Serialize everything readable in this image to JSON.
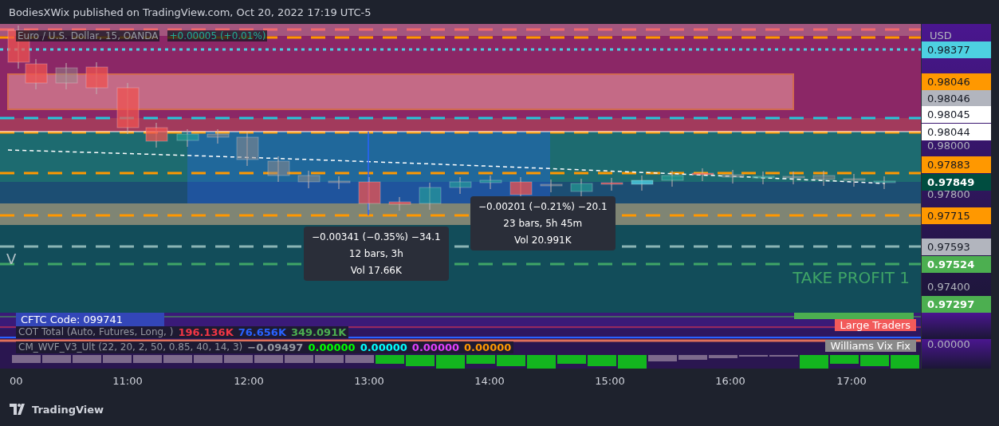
{
  "header": {
    "title": "BodiesXWix published on TradingView.com, Oct 20, 2022 17:19 UTC-5"
  },
  "main_pane": {
    "symbol": "Euro / U.S. Dollar, 15, OANDA",
    "change": "+0.00005 (+0.01%)",
    "edge_label": "V",
    "zone_label": "TAKE PROFIT 1",
    "tooltips": [
      {
        "lines": [
          "−0.00341 (−0.35%) −34.1",
          "12 bars, 3h",
          "Vol 17.66K"
        ]
      },
      {
        "lines": [
          "−0.00201 (−0.21%) −20.1",
          "23 bars, 5h 45m",
          "Vol 20.991K"
        ]
      }
    ]
  },
  "price_axis": {
    "currency": "USD",
    "labels": [
      {
        "text": "0.98377",
        "kind": "marker",
        "color": "#4dd0e1"
      },
      {
        "text": "0.98046",
        "kind": "marker",
        "color": "#ff9800"
      },
      {
        "text": "0.98046",
        "kind": "marker",
        "color": "#b2b5be"
      },
      {
        "text": "0.98045",
        "kind": "marker",
        "color": "#ffffff"
      },
      {
        "text": "0.98044",
        "kind": "marker",
        "color": "#ffffff"
      },
      {
        "text": "0.98000",
        "kind": "tick"
      },
      {
        "text": "0.97883",
        "kind": "marker",
        "color": "#ff9800"
      },
      {
        "text": "0.97849",
        "kind": "marker",
        "color": "#004d40"
      },
      {
        "text": "0.97800",
        "kind": "tick"
      },
      {
        "text": "0.97715",
        "kind": "marker",
        "color": "#ff9800"
      },
      {
        "text": "0.97593",
        "kind": "marker",
        "color": "#b2b5be"
      },
      {
        "text": "0.97524",
        "kind": "marker",
        "color": "#4caf50"
      },
      {
        "text": "0.97400",
        "kind": "tick"
      },
      {
        "text": "0.97297",
        "kind": "marker",
        "color": "#4caf50"
      }
    ]
  },
  "cot_pane": {
    "code_label": "CFTC Code: 099741",
    "legend": "COT Total (Auto, Futures, Long, )",
    "values": [
      {
        "text": "196.136K"
      },
      {
        "text": "76.656K"
      },
      {
        "text": "349.091K"
      }
    ],
    "series_label": "Large Traders"
  },
  "wvf_pane": {
    "legend": "CM_WVF_V3_Ult (22, 20, 2, 50, 0.85, 40, 14, 3)",
    "values": [
      {
        "text": "−0.09497"
      },
      {
        "text": "0.00000"
      },
      {
        "text": "0.00000"
      },
      {
        "text": "0.00000"
      },
      {
        "text": "0.00000"
      }
    ],
    "series_label": "Williams Vix Fix",
    "axis_value": "0.00000"
  },
  "time_axis": [
    "00",
    "11:00",
    "12:00",
    "13:00",
    "14:00",
    "15:00",
    "16:00",
    "17:00"
  ],
  "footer": {
    "brand": "TradingView"
  }
}
